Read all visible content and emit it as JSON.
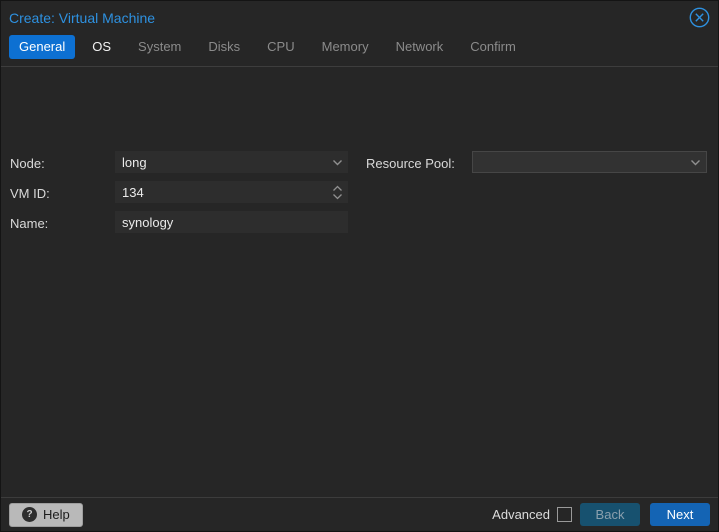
{
  "window": {
    "title": "Create: Virtual Machine"
  },
  "tabs": [
    {
      "label": "General",
      "state": "active"
    },
    {
      "label": "OS",
      "state": "enabled"
    },
    {
      "label": "System",
      "state": "disabled"
    },
    {
      "label": "Disks",
      "state": "disabled"
    },
    {
      "label": "CPU",
      "state": "disabled"
    },
    {
      "label": "Memory",
      "state": "disabled"
    },
    {
      "label": "Network",
      "state": "disabled"
    },
    {
      "label": "Confirm",
      "state": "disabled"
    }
  ],
  "form": {
    "node": {
      "label": "Node:",
      "value": "long"
    },
    "vmid": {
      "label": "VM ID:",
      "value": "134"
    },
    "name": {
      "label": "Name:",
      "value": "synology"
    },
    "resource_pool": {
      "label": "Resource Pool:",
      "value": ""
    }
  },
  "footer": {
    "help_label": "Help",
    "advanced_label": "Advanced",
    "advanced_checked": false,
    "back_label": "Back",
    "back_enabled": false,
    "next_label": "Next",
    "next_enabled": true
  },
  "icons": {
    "close": "circled-x-icon",
    "help": "question-mark-icon",
    "node_picker": "chevron-down-icon",
    "vmid_picker": "spinner-up-down-icon",
    "pool_picker": "chevron-down-icon"
  },
  "colors": {
    "dialog_background": "#262626",
    "title_blue": "#2e91e0",
    "active_tab_blue": "#0d70d2",
    "disabled_tab_gray": "#8b8b8b",
    "field_background": "#2d2d2d",
    "next_button_blue": "#1464b4",
    "back_button_blue": "#17516f",
    "help_button_gray": "#b9b9b9"
  }
}
